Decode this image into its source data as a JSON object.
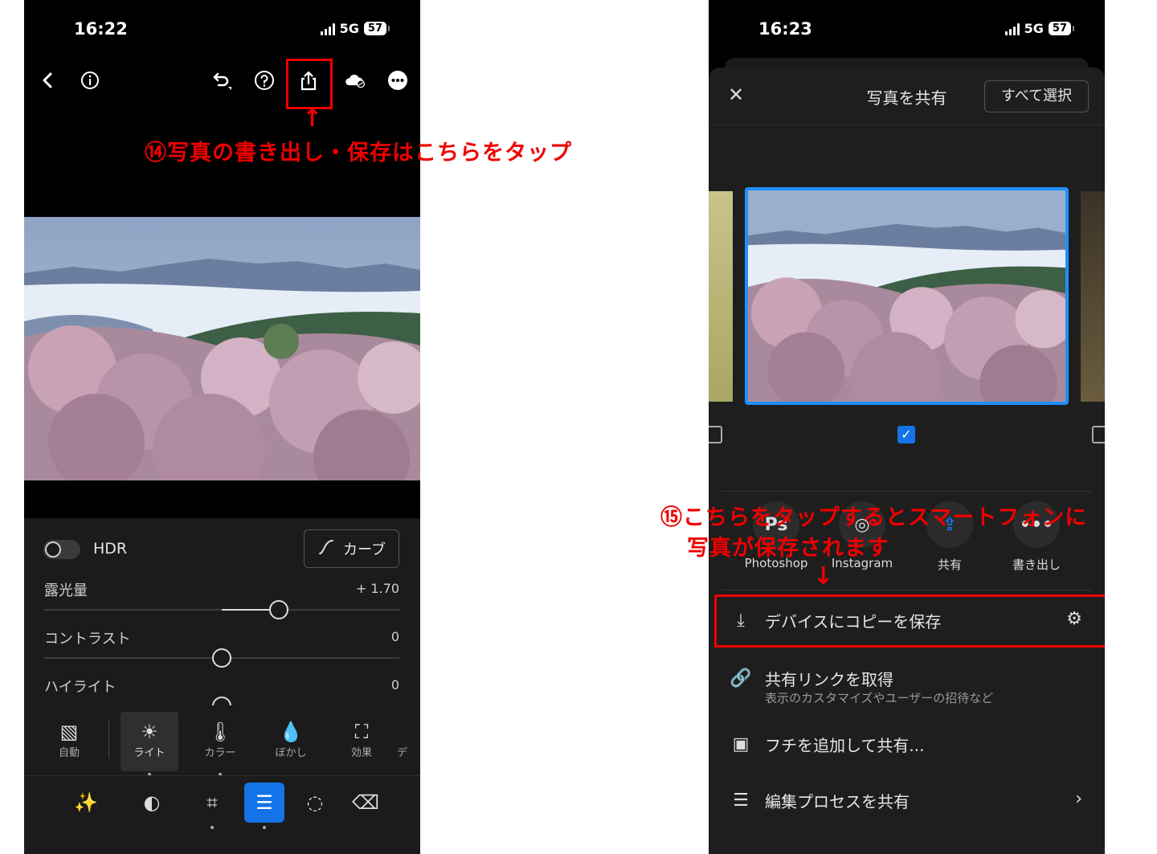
{
  "left_screen": {
    "status": {
      "time": "16:22",
      "network": "5G",
      "battery": "57"
    },
    "annotation_text": "⑭写真の書き出し・保存はこちらをタップ",
    "annotation_arrow": "↑",
    "hdr_label": "HDR",
    "curve_label": "カーブ",
    "sliders": [
      {
        "label": "露光量",
        "value": "+ 1.70"
      },
      {
        "label": "コントラスト",
        "value": "0"
      },
      {
        "label": "ハイライト",
        "value": "0"
      }
    ],
    "tools": [
      {
        "label": "自動",
        "icon": "auto-photo-icon"
      },
      {
        "label": "ライト",
        "icon": "sun-icon"
      },
      {
        "label": "カラー",
        "icon": "thermometer-icon"
      },
      {
        "label": "ぼかし",
        "icon": "droplet-icon"
      },
      {
        "label": "効果",
        "icon": "vignette-icon"
      },
      {
        "label": "デ",
        "icon": ""
      }
    ],
    "bottom_icons": [
      "magic-wand-icon",
      "mask-icon",
      "crop-icon",
      "sliders-icon",
      "selective-icon",
      "eraser-icon"
    ]
  },
  "right_screen": {
    "status": {
      "time": "16:23",
      "network": "5G",
      "battery": "57"
    },
    "title": "写真を共有",
    "select_all": "すべて選択",
    "checkmark": "✓",
    "apps": [
      {
        "label": "Photoshop",
        "glyph": "Ps"
      },
      {
        "label": "Instagram",
        "glyph": "◎"
      },
      {
        "label": "共有",
        "glyph": "⇪"
      },
      {
        "label": "書き出し",
        "glyph": "•••"
      }
    ],
    "annotation_text_1": "⑮こちらをタップするとスマートフォンに",
    "annotation_text_2": "写真が保存されます",
    "annotation_arrow": "↓",
    "rows": [
      {
        "title": "デバイスにコピーを保存",
        "subtitle": "",
        "icon": "download-icon",
        "end": "⚙"
      },
      {
        "title": "共有リンクを取得",
        "subtitle": "表示のカスタマイズやユーザーの招待など",
        "icon": "link-icon",
        "end": ""
      },
      {
        "title": "フチを追加して共有...",
        "subtitle": "",
        "icon": "frame-icon",
        "end": ""
      },
      {
        "title": "編集プロセスを共有",
        "subtitle": "",
        "icon": "sliders-icon",
        "end": "›"
      }
    ],
    "colors": {
      "accent": "#1473e6",
      "annotation": "#e00000"
    }
  }
}
